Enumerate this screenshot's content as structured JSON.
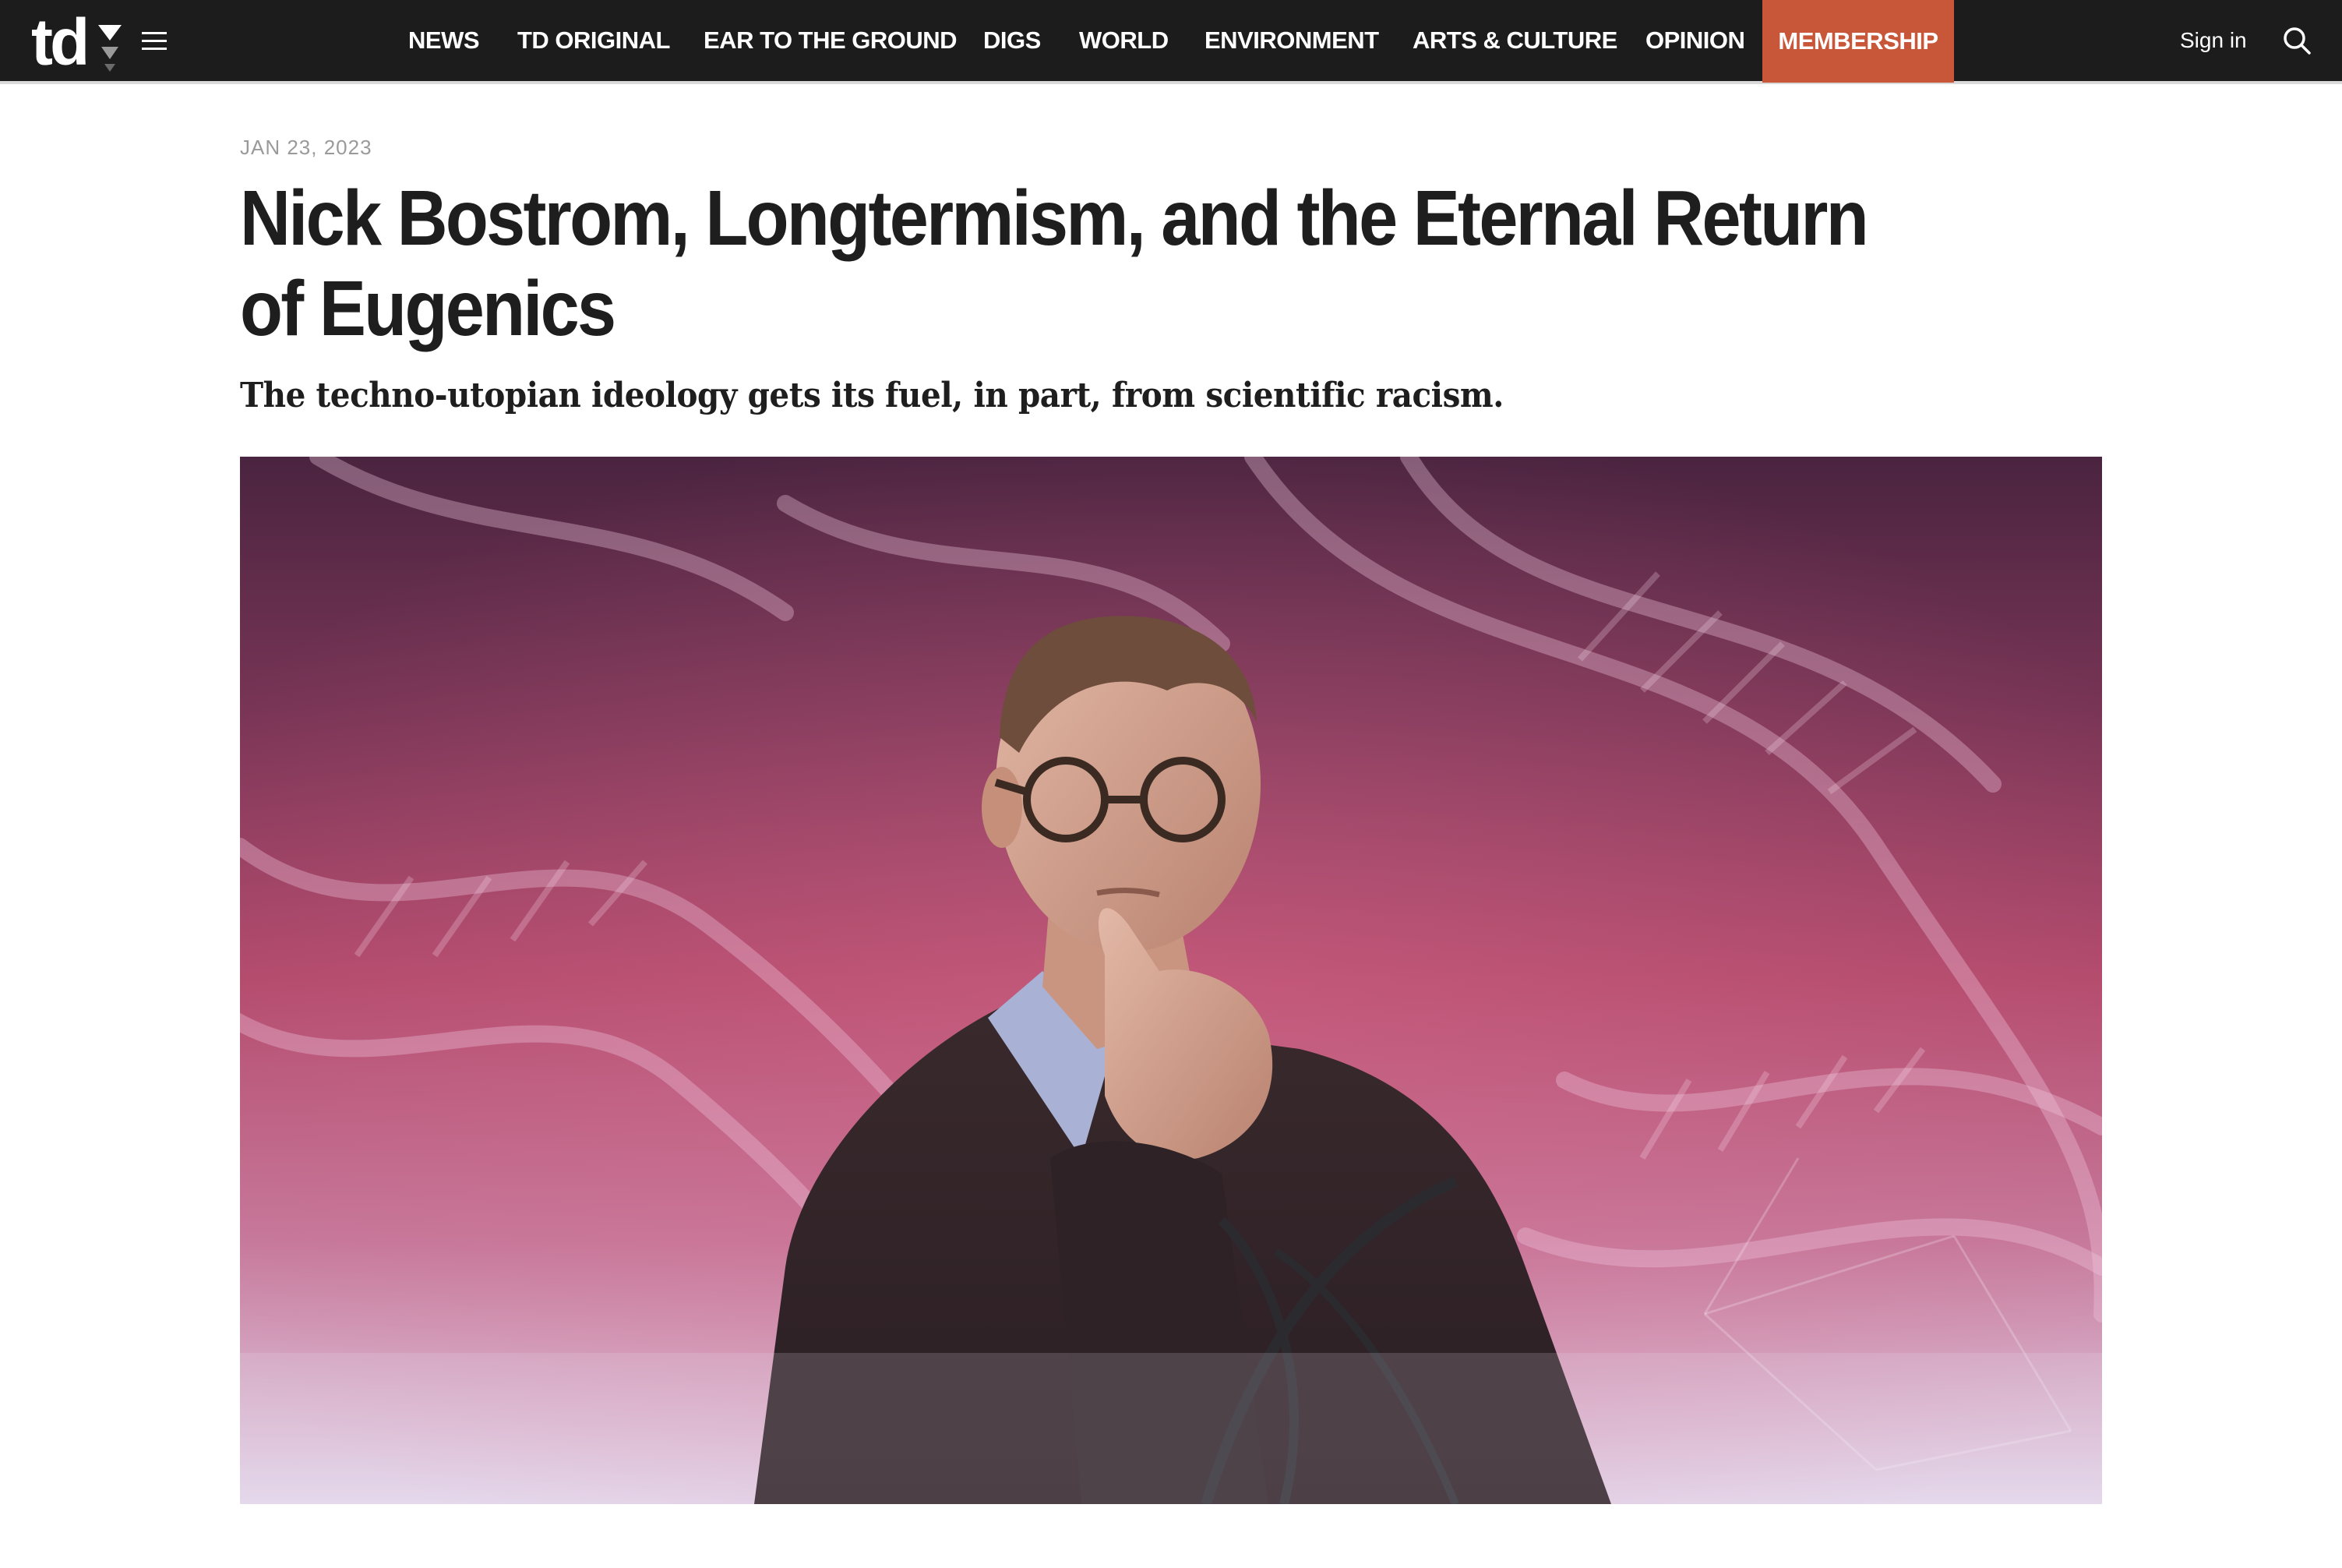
{
  "site": {
    "logo": "td",
    "logo_icon": "triangle-down-icon"
  },
  "nav": {
    "items": [
      {
        "label": "NEWS"
      },
      {
        "label": "TD ORIGINAL"
      },
      {
        "label": "EAR TO THE GROUND"
      },
      {
        "label": "DIGS"
      },
      {
        "label": "WORLD"
      },
      {
        "label": "ENVIRONMENT"
      },
      {
        "label": "ARTS & CULTURE"
      },
      {
        "label": "OPINION"
      },
      {
        "label": "MEMBERSHIP"
      }
    ],
    "sign_in": "Sign in",
    "menu_icon": "hamburger-icon",
    "search_icon": "search-icon"
  },
  "article": {
    "date": "JAN 23, 2023",
    "title": "Nick Bostrom, Longtermism, and the Eternal Return of Eugenics",
    "dek": "The techno-utopian ideology gets its fuel, in part, from scientific racism.",
    "hero_image": "portrait-over-dna-helix-background"
  },
  "colors": {
    "nav_background": "#1c1c1c",
    "membership_accent": "#c8573a",
    "headline": "#1e1e1e",
    "date": "#9a9a9a",
    "hero_top": "#4a2440",
    "hero_mid": "#b24a6c",
    "hero_bottom": "#e4d8ec"
  }
}
